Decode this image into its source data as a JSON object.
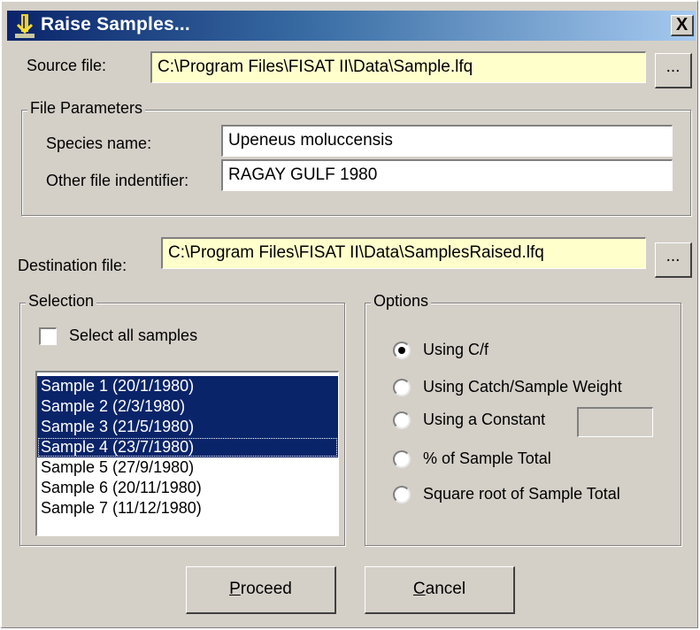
{
  "window": {
    "title": "Raise Samples...",
    "close_label": "X",
    "icon": "fish-app-icon"
  },
  "source": {
    "label": "Source file:",
    "value": "C:\\Program Files\\FISAT II\\Data\\Sample.lfq",
    "browse_label": "..."
  },
  "file_parameters": {
    "legend": "File Parameters",
    "species_label": "Species name:",
    "species_value": "Upeneus moluccensis",
    "other_label": "Other file indentifier:",
    "other_value": "RAGAY GULF 1980"
  },
  "destination": {
    "label": "Destination file:",
    "value": "C:\\Program Files\\FISAT II\\Data\\SamplesRaised.lfq",
    "browse_label": "..."
  },
  "selection": {
    "legend": "Selection",
    "select_all_label": "Select all samples",
    "select_all_checked": false,
    "samples": [
      {
        "label": "Sample 1 (20/1/1980)",
        "selected": true
      },
      {
        "label": "Sample 2 (2/3/1980)",
        "selected": true
      },
      {
        "label": "Sample 3 (21/5/1980)",
        "selected": true
      },
      {
        "label": "Sample 4 (23/7/1980)",
        "selected": true,
        "focused": true
      },
      {
        "label": "Sample 5 (27/9/1980)",
        "selected": false
      },
      {
        "label": "Sample 6 (20/11/1980)",
        "selected": false
      },
      {
        "label": "Sample 7 (11/12/1980)",
        "selected": false
      }
    ]
  },
  "options": {
    "legend": "Options",
    "items": [
      {
        "label": "Using C/f",
        "checked": true
      },
      {
        "label": "Using Catch/Sample Weight",
        "checked": false
      },
      {
        "label": "Using a Constant",
        "checked": false
      },
      {
        "label": "% of Sample Total",
        "checked": false
      },
      {
        "label": "Square root of Sample Total",
        "checked": false
      }
    ],
    "constant_value": ""
  },
  "buttons": {
    "proceed_first": "P",
    "proceed_rest": "roceed",
    "cancel_first": "C",
    "cancel_rest": "ancel"
  },
  "colors": {
    "selection": "#0a246a",
    "field_yellow": "#ffffcc",
    "dialog_face": "#d4d0c8"
  }
}
